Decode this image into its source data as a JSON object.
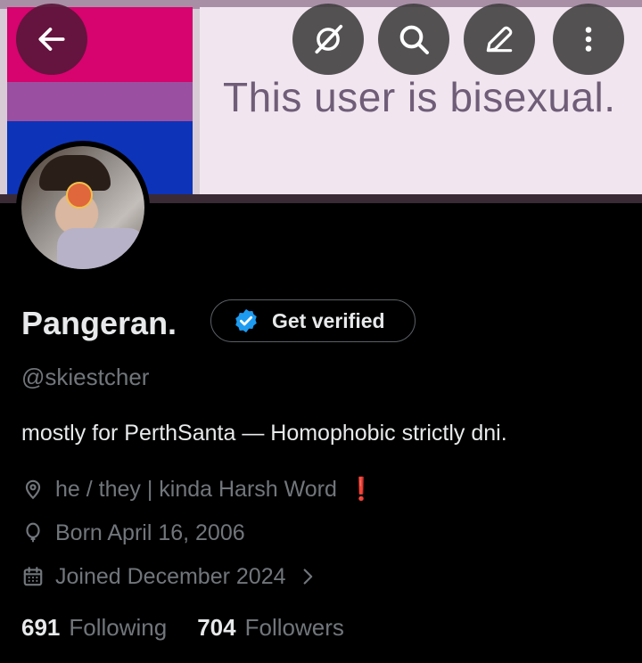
{
  "banner": {
    "text": "This user is bisexual."
  },
  "header": {
    "back_icon": "arrow-left-icon",
    "grok_icon": "grok-icon",
    "search_icon": "search-icon",
    "edit_icon": "pencil-icon",
    "more_icon": "more-vertical-icon"
  },
  "profile": {
    "name": "Pangeran.",
    "verify_label": "Get verified",
    "handle": "@skiestcher",
    "bio": "mostly for PerthSanta — Homophobic strictly dni.",
    "location": "he / they | kinda Harsh Word",
    "location_mark": "❗",
    "birthday": "Born April 16, 2006",
    "joined": "Joined December 2024"
  },
  "stats": {
    "following_count": "691",
    "following_label": "Following",
    "followers_count": "704",
    "followers_label": "Followers"
  },
  "colors": {
    "accent": "#1d9bf0",
    "muted": "#71767b",
    "text": "#e7e9ea",
    "alert": "#e0245e"
  }
}
